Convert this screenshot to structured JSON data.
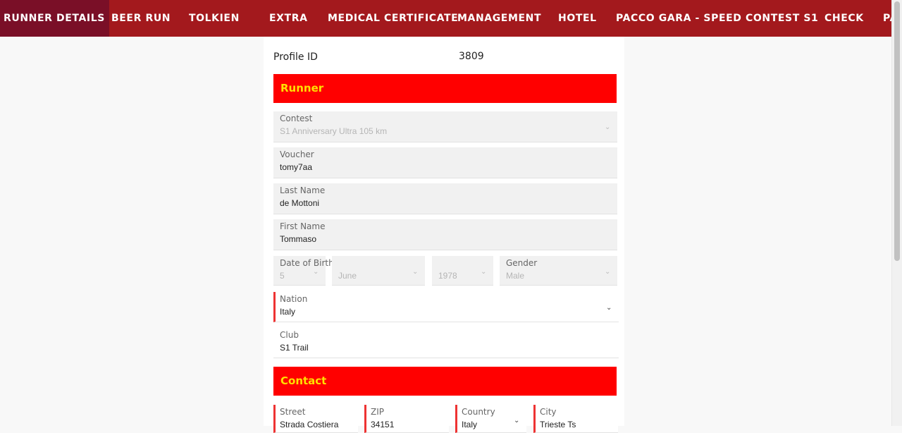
{
  "nav": {
    "tabs": [
      {
        "label": "RUNNER DETAILS",
        "active": true
      },
      {
        "label": "BEER RUN"
      },
      {
        "label": "TOLKIEN"
      },
      {
        "label": "EXTRA"
      },
      {
        "label": "MEDICAL CERTIFICATE"
      },
      {
        "label": "MANAGEMENT"
      },
      {
        "label": "HOTEL"
      },
      {
        "label": "PACCO GARA - SPEED CONTEST S1"
      },
      {
        "label": "CHECK"
      },
      {
        "label": "PA"
      }
    ]
  },
  "profile": {
    "label": "Profile ID",
    "value": "3809"
  },
  "sections": {
    "runner": "Runner",
    "contact": "Contact"
  },
  "fields": {
    "contest": {
      "label": "Contest",
      "value": "S1 Anniversary Ultra 105 km"
    },
    "voucher": {
      "label": "Voucher",
      "value": "tomy7aa"
    },
    "last_name": {
      "label": "Last Name",
      "value": "de Mottoni"
    },
    "first_name": {
      "label": "First Name",
      "value": "Tommaso"
    },
    "dob": {
      "label": "Date of Birth",
      "day": "5",
      "month": "June",
      "year": "1978"
    },
    "gender": {
      "label": "Gender",
      "value": "Male"
    },
    "nation": {
      "label": "Nation",
      "value": "Italy"
    },
    "club": {
      "label": "Club",
      "value": "S1 Trail"
    },
    "street": {
      "label": "Street",
      "value": "Strada Costiera"
    },
    "zip": {
      "label": "ZIP",
      "value": "34151"
    },
    "country": {
      "label": "Country",
      "value": "Italy"
    },
    "city": {
      "label": "City",
      "value": "Trieste Ts"
    }
  },
  "colors": {
    "nav_bg": "#a3191d",
    "nav_active": "#7a0f27",
    "section_bg": "#ff0000",
    "section_text": "#ffe000",
    "required_marker": "#ee3333"
  },
  "icons": {
    "select_arrow": "chevron-down-icon"
  }
}
